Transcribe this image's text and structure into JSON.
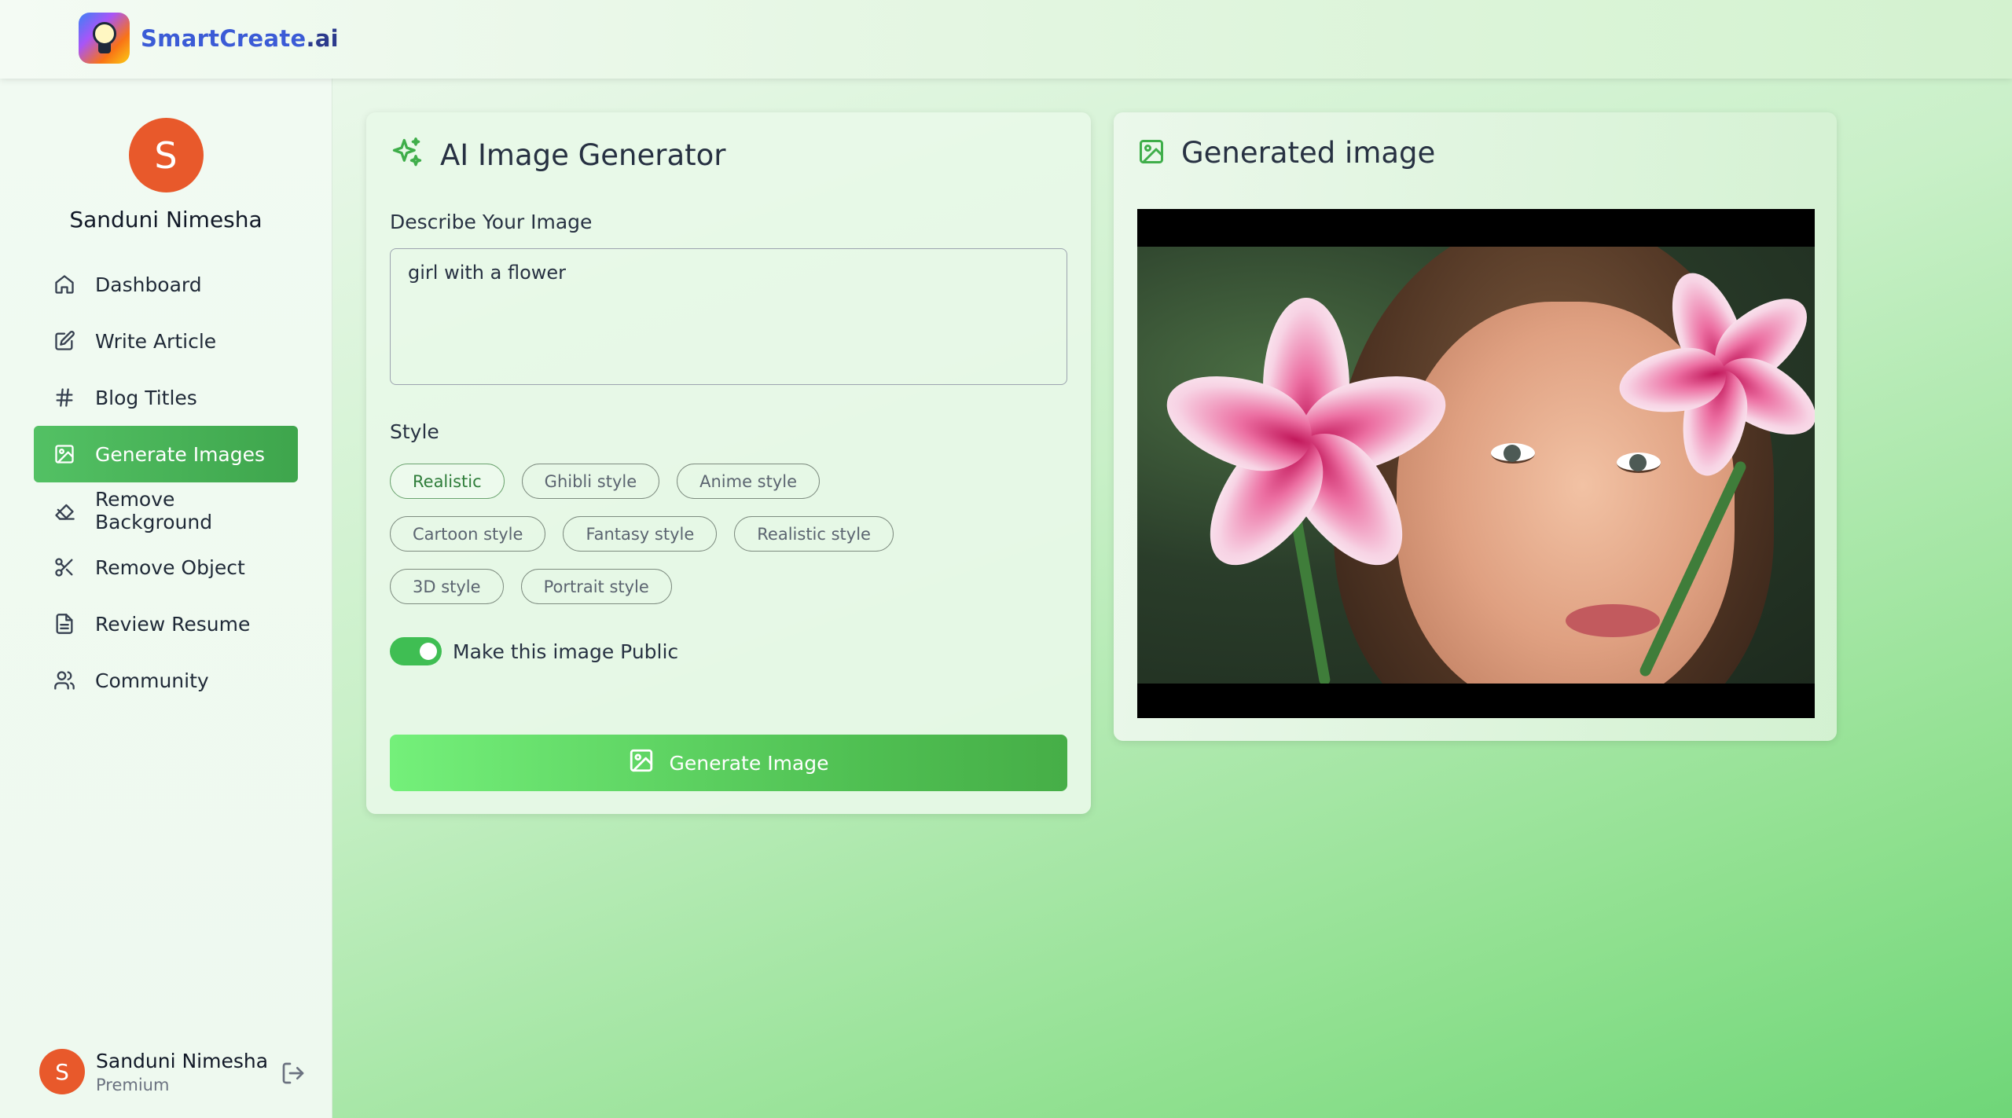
{
  "app": {
    "logo_part1": "SmartCreate",
    "logo_part2": ".ai",
    "logo_icon": "lightbulb-icon"
  },
  "user": {
    "initial": "S",
    "name": "Sanduni Nimesha",
    "plan": "Premium"
  },
  "sidebar": {
    "items": [
      {
        "label": "Dashboard",
        "icon": "home-icon",
        "active": false
      },
      {
        "label": "Write Article",
        "icon": "edit-icon",
        "active": false
      },
      {
        "label": "Blog Titles",
        "icon": "hash-icon",
        "active": false
      },
      {
        "label": "Generate Images",
        "icon": "image-icon",
        "active": true
      },
      {
        "label": "Remove Background",
        "icon": "eraser-icon",
        "active": false
      },
      {
        "label": "Remove Object",
        "icon": "scissors-icon",
        "active": false
      },
      {
        "label": "Review Resume",
        "icon": "file-text-icon",
        "active": false
      },
      {
        "label": "Community",
        "icon": "users-icon",
        "active": false
      }
    ],
    "logout_icon": "logout-icon"
  },
  "generator": {
    "title": "AI Image Generator",
    "prompt_label": "Describe Your Image",
    "prompt_value": "girl with a flower",
    "style_label": "Style",
    "styles": [
      [
        "Realistic",
        "Ghibli style",
        "Anime style"
      ],
      [
        "Cartoon style",
        "Fantasy style",
        "Realistic style"
      ],
      [
        "3D style",
        "Portrait style"
      ]
    ],
    "selected_style": "Realistic",
    "public_toggle_label": "Make this image Public",
    "public_toggle_on": true,
    "generate_button": "Generate Image"
  },
  "result": {
    "title": "Generated image"
  },
  "colors": {
    "accent_green": "#4fbf52",
    "avatar_orange": "#e8592b",
    "active_nav": "#53c164"
  }
}
